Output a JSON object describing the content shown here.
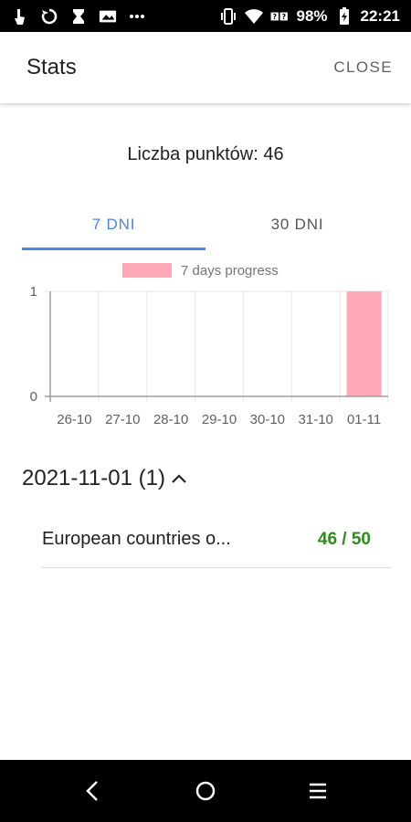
{
  "status_bar": {
    "battery": "98%",
    "time": "22:21",
    "icons": [
      "touch-icon",
      "sync-icon",
      "hourglass-icon",
      "image-icon",
      "more-dots-icon",
      "vibrate-icon",
      "wifi-icon",
      "signal-unknown-icon",
      "battery-charging-icon"
    ]
  },
  "app_bar": {
    "title": "Stats",
    "close_label": "CLOSE"
  },
  "points_label": "Liczba punktów: 46",
  "tabs": [
    {
      "label": "7 DNI",
      "active": true
    },
    {
      "label": "30 DNI",
      "active": false
    }
  ],
  "chart_data": {
    "type": "bar",
    "legend": "7 days progress",
    "legend_position": "top",
    "categories": [
      "26-10",
      "27-10",
      "28-10",
      "29-10",
      "30-10",
      "31-10",
      "01-11"
    ],
    "values": [
      0,
      0,
      0,
      0,
      0,
      0,
      1
    ],
    "ylim": [
      0,
      1
    ],
    "yticks": [
      "0",
      "1"
    ],
    "grid": true,
    "color": "#ffa8b8"
  },
  "day_group": {
    "label": "2021-11-01 (1)",
    "expanded": true
  },
  "items": [
    {
      "name": "European countries o...",
      "score": "46 / 50"
    }
  ],
  "colors": {
    "accent": "#4a86e8",
    "score": "#2e8b1f",
    "bar": "#ffa8b8"
  }
}
